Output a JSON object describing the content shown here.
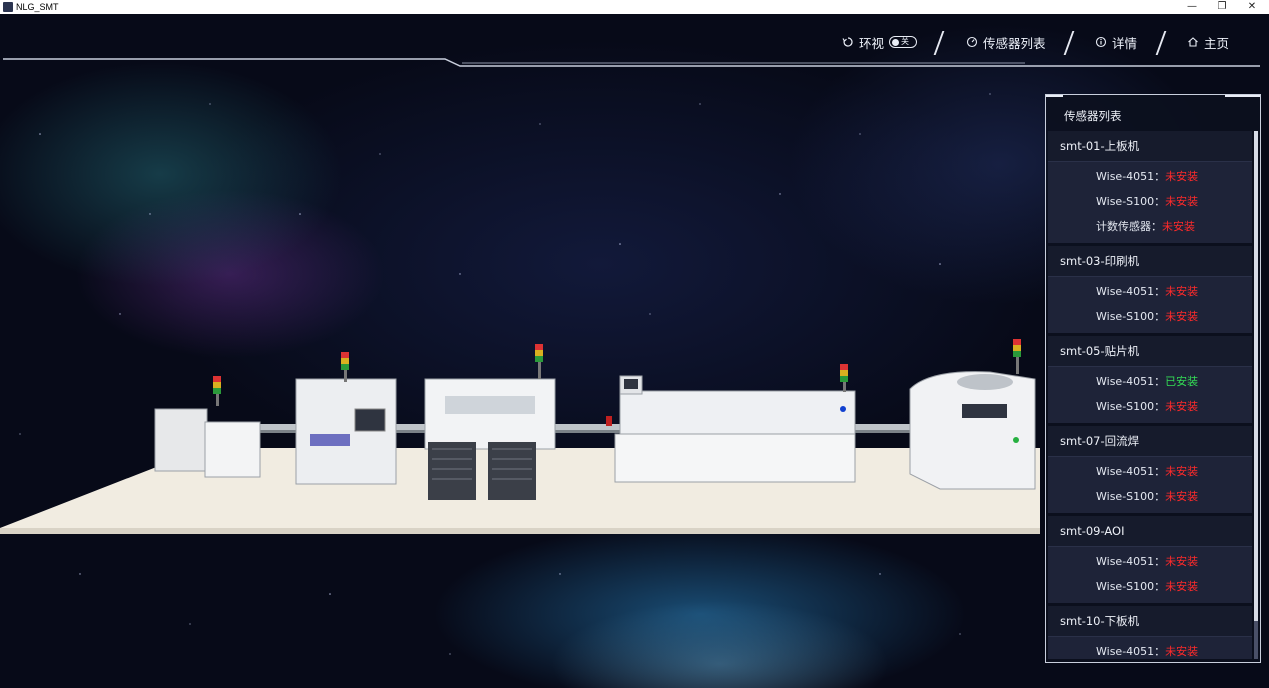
{
  "window": {
    "title": "NLG_SMT",
    "minimize_label": "—",
    "restore_label": "❐",
    "close_label": "✕"
  },
  "nav": {
    "surround": {
      "label": "环视",
      "toggle_state": "关"
    },
    "sensor_list": {
      "label": "传感器列表"
    },
    "details": {
      "label": "详情"
    },
    "home": {
      "label": "主页"
    }
  },
  "panel": {
    "title": "传感器列表",
    "groups": [
      {
        "name": "smt-01-上板机",
        "sensors": [
          {
            "label": "Wise-4051：",
            "status": "未安装",
            "installed": false
          },
          {
            "label": "Wise-S100：",
            "status": "未安装",
            "installed": false
          },
          {
            "label": "计数传感器：",
            "status": "未安装",
            "installed": false
          }
        ]
      },
      {
        "name": "smt-03-印刷机",
        "sensors": [
          {
            "label": "Wise-4051：",
            "status": "未安装",
            "installed": false
          },
          {
            "label": "Wise-S100：",
            "status": "未安装",
            "installed": false
          }
        ]
      },
      {
        "name": "smt-05-贴片机",
        "sensors": [
          {
            "label": "Wise-4051：",
            "status": "已安装",
            "installed": true
          },
          {
            "label": "Wise-S100：",
            "status": "未安装",
            "installed": false
          }
        ]
      },
      {
        "name": "smt-07-回流焊",
        "sensors": [
          {
            "label": "Wise-4051：",
            "status": "未安装",
            "installed": false
          },
          {
            "label": "Wise-S100：",
            "status": "未安装",
            "installed": false
          }
        ]
      },
      {
        "name": "smt-09-AOI",
        "sensors": [
          {
            "label": "Wise-4051：",
            "status": "未安装",
            "installed": false
          },
          {
            "label": "Wise-S100：",
            "status": "未安装",
            "installed": false
          }
        ]
      },
      {
        "name": "smt-10-下板机",
        "sensors": [
          {
            "label": "Wise-4051：",
            "status": "未安装",
            "installed": false
          }
        ]
      }
    ]
  },
  "colors": {
    "not_installed": "#ff2a2a",
    "installed": "#33dd55",
    "panel_bg": "#161b2c"
  }
}
